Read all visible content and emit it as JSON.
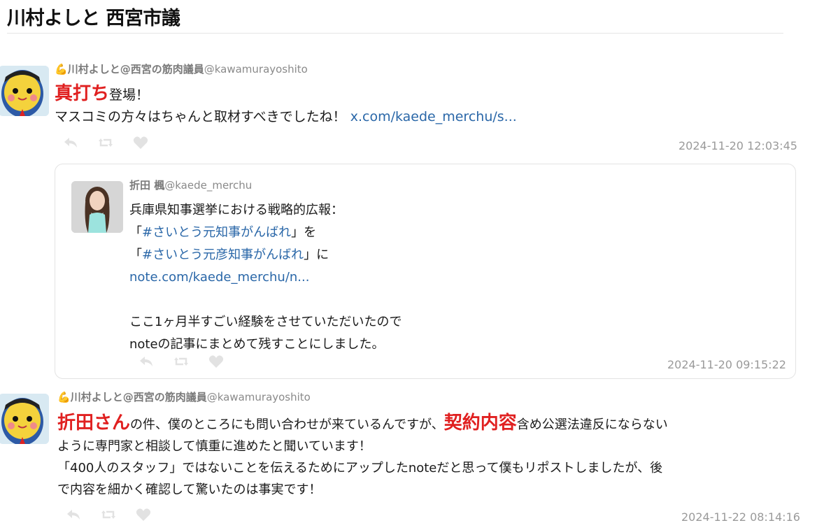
{
  "page": {
    "title": "川村よしと 西宮市議"
  },
  "post1": {
    "author_emoji": "💪",
    "author_name": "川村よしと@西宮の筋肉議員",
    "handle": "@kawamurayoshito",
    "line1_highlight": "真打ち",
    "line1_rest": "登場！",
    "line2_text": "マスコミの方々はちゃんと取材すべきでしたね！",
    "line2_link": "x.com/kaede_merchu/s...",
    "timestamp": "2024-11-20 12:03:45"
  },
  "quote": {
    "author_name": "折田 楓",
    "handle": "@kaede_merchu",
    "lines": [
      "兵庫県知事選挙における戦略的広報：",
      "「",
      "#さいとう元知事がんばれ",
      "」を",
      "「",
      "#さいとう元彦知事がんばれ",
      "」に",
      "note.com/kaede_merchu/n...",
      "ここ1ヶ月半すごい経験をさせていただいたので",
      "noteの記事にまとめて残すことにしました。"
    ],
    "timestamp": "2024-11-20 09:15:22"
  },
  "post2": {
    "author_emoji": "💪",
    "author_name": "川村よしと@西宮の筋肉議員",
    "handle": "@kawamurayoshito",
    "hl1": "折田さん",
    "seg1": "の件、僕のところにも問い合わせが来ているんですが、",
    "hl2": "契約内容",
    "seg2": "含め公選法違反にならない",
    "line2": "ように専門家と相談して慎重に進めたと聞いています！",
    "line3": "「400人のスタッフ」ではないことを伝えるためにアップしたnoteだと思って僕もリポストしましたが、後",
    "line4": "で内容を細かく確認して驚いたのは事実です！",
    "timestamp": "2024-11-22 08:14:16"
  },
  "icons": [
    "reply-icon",
    "retweet-icon",
    "like-icon"
  ],
  "colors": {
    "highlight": "#e02020",
    "link": "#2a67a8",
    "meta": "#9a9a9a"
  }
}
